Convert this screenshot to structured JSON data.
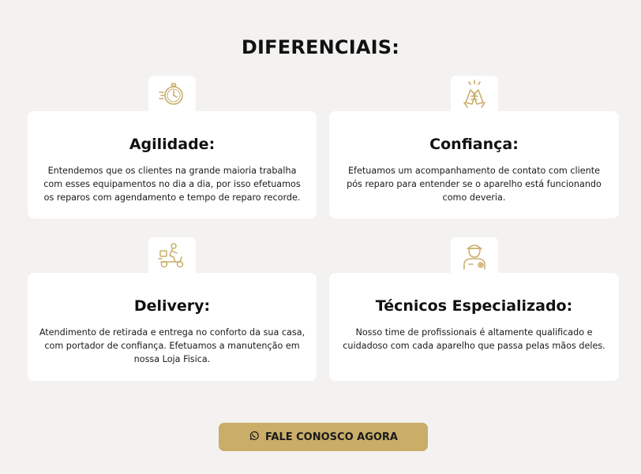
{
  "section": {
    "title": "DIFERENCIAIS:"
  },
  "cards": [
    {
      "icon": "stopwatch-icon",
      "title": "Agilidade:",
      "text": "Entendemos que os clientes na grande maioria trabalha com esses equipamentos no dia a dia, por isso efetuamos os reparos com agendamento e tempo de reparo recorde."
    },
    {
      "icon": "handshake-icon",
      "title": "Confiança:",
      "text": "Efetuamos um acompanhamento de contato com cliente pós reparo para entender se o aparelho está funcionando como deveria."
    },
    {
      "icon": "delivery-scooter-icon",
      "title": "Delivery:",
      "text": "Atendimento de retirada e entrega no conforto da sua casa, com portador de confiança. Efetuamos a manutenção em nossa Loja Fisica."
    },
    {
      "icon": "technician-icon",
      "title": "Técnicos Especializado:",
      "text": "Nosso time de profissionais é altamente qualificado e cuidadoso com cada aparelho que passa pelas mãos deles."
    }
  ],
  "cta": {
    "label": "FALE CONOSCO AGORA",
    "icon": "whatsapp-icon"
  },
  "colors": {
    "accent": "#c9ad69",
    "background": "#f3f2f0",
    "card": "#ffffff"
  }
}
